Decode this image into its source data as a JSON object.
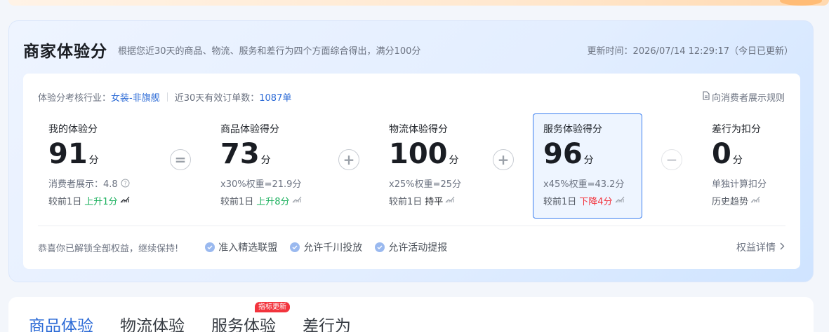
{
  "header": {
    "title": "商家体验分",
    "subtitle": "根据您近30天的商品、物流、服务和差行为四个方面综合得出，满分100分",
    "update_time": "更新时间：2026/07/14 12:29:17（今日已更新）"
  },
  "meta": {
    "industry_label": "体验分考核行业：",
    "industry_value": "女装-非旗舰",
    "orders_label": "近30天有效订单数：",
    "orders_value": "1087单",
    "rules_link": "向消费者展示规则"
  },
  "metrics": [
    {
      "label": "我的体验分",
      "score": "91",
      "unit": "分",
      "line1": "消费者展示：4.8",
      "compare_prefix": "较前1日",
      "compare_value": "上升1分",
      "compare_status": "up"
    },
    {
      "label": "商品体验得分",
      "score": "73",
      "unit": "分",
      "line1": "x30%权重=21.9分",
      "compare_prefix": "较前1日",
      "compare_value": "上升8分",
      "compare_status": "up"
    },
    {
      "label": "物流体验得分",
      "score": "100",
      "unit": "分",
      "line1": "x25%权重=25分",
      "compare_prefix": "较前1日",
      "compare_value": "持平",
      "compare_status": "flat"
    },
    {
      "label": "服务体验得分",
      "score": "96",
      "unit": "分",
      "line1": "x45%权重=43.2分",
      "compare_prefix": "较前1日",
      "compare_value": "下降4分",
      "compare_status": "down"
    },
    {
      "label": "差行为扣分",
      "score": "0",
      "unit": "分",
      "line1": "单独计算扣分",
      "compare_prefix": "历史趋势",
      "compare_value": "",
      "compare_status": "none"
    }
  ],
  "operators": [
    "=",
    "+",
    "+",
    "−"
  ],
  "footer": {
    "message": "恭喜你已解锁全部权益，继续保持!",
    "perks": [
      "准入精选联盟",
      "允许千川投放",
      "允许活动提报"
    ],
    "benefits_link": "权益详情"
  },
  "tabs": [
    {
      "label": "商品体验",
      "active": true
    },
    {
      "label": "物流体验",
      "active": false
    },
    {
      "label": "服务体验",
      "active": false
    },
    {
      "label": "差行为",
      "active": false
    }
  ],
  "tab_badge": "指标更新",
  "colors": {
    "accent": "#2b6ad6",
    "up": "#1bb05d",
    "down": "#f2343d",
    "highlight_border": "#3b7ef0"
  }
}
